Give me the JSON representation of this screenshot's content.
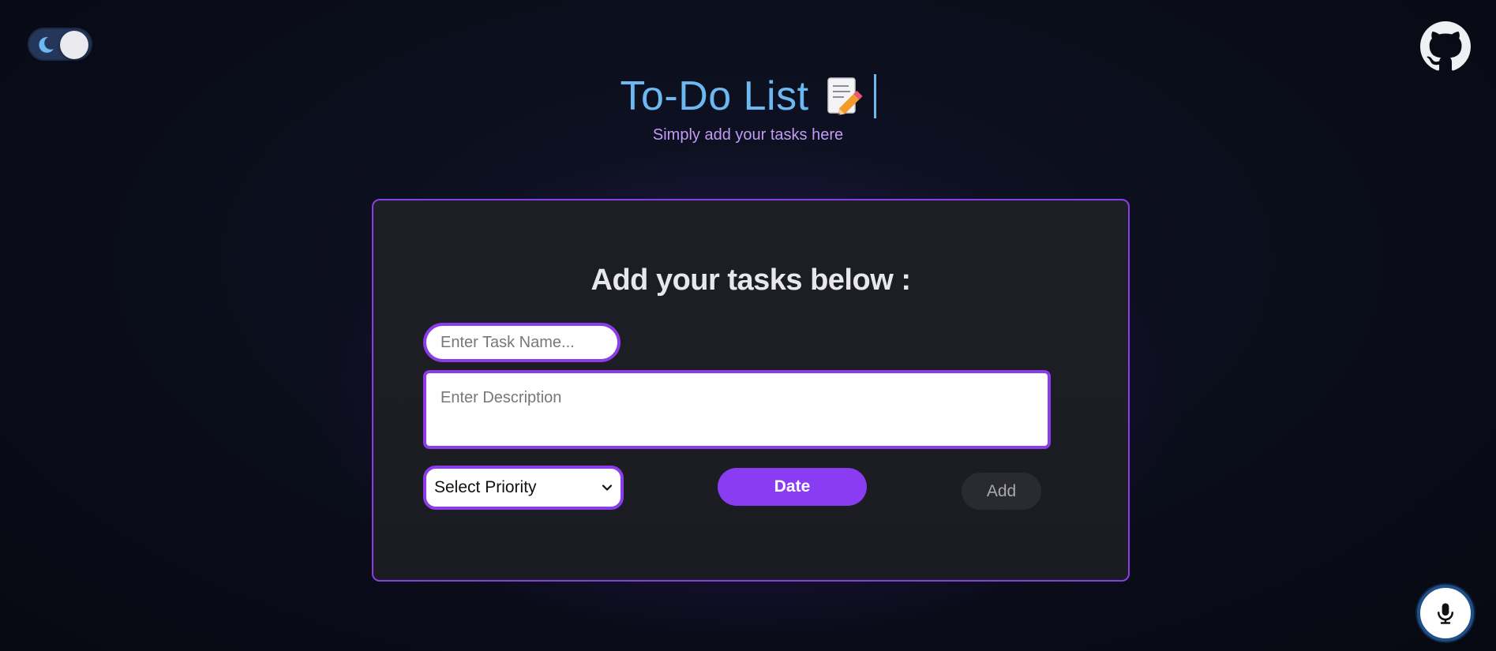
{
  "header": {
    "title": "To-Do List",
    "subtitle": "Simply add your tasks here"
  },
  "icons": {
    "theme_toggle": "moon-icon",
    "title_emoji": "memo-icon",
    "github": "github-icon",
    "mic": "microphone-icon",
    "select_arrow": "chevron-down-icon"
  },
  "card": {
    "heading": "Add your tasks below :",
    "task_name_placeholder": "Enter Task Name...",
    "description_placeholder": "Enter Description",
    "priority_selected": "Select Priority",
    "date_label": "Date",
    "add_label": "Add"
  },
  "colors": {
    "accent": "#8b3dea",
    "title": "#6cb8f0",
    "subtitle": "#c39bf4",
    "background": "#0b0e1c"
  }
}
